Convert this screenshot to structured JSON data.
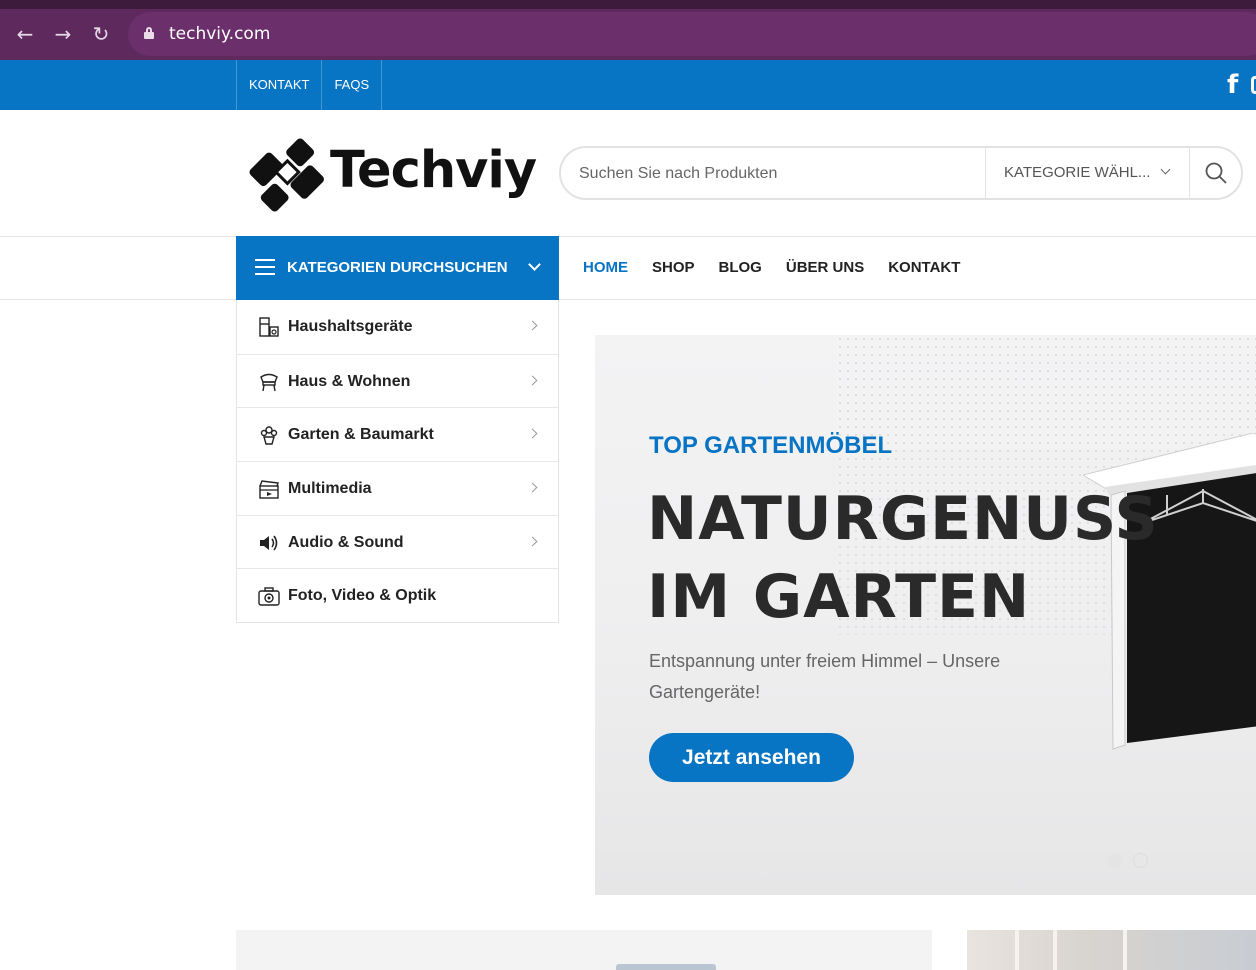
{
  "browser": {
    "url": "techviy.com"
  },
  "topbar": {
    "links": [
      "KONTAKT",
      "FAQS"
    ]
  },
  "header": {
    "logo_text": "Techviy",
    "search_placeholder": "Suchen Sie nach Produkten",
    "category_select": "KATEGORIE WÄHL..."
  },
  "categories": {
    "button_label": "KATEGORIEN DURCHSUCHEN",
    "items": [
      {
        "label": "Haushaltsgeräte",
        "icon": "appliance-icon",
        "has_arrow": true
      },
      {
        "label": "Haus & Wohnen",
        "icon": "chair-icon",
        "has_arrow": true
      },
      {
        "label": "Garten & Baumarkt",
        "icon": "plant-pot-icon",
        "has_arrow": true
      },
      {
        "label": "Multimedia",
        "icon": "clapperboard-icon",
        "has_arrow": true
      },
      {
        "label": "Audio & Sound",
        "icon": "speaker-icon",
        "has_arrow": true
      },
      {
        "label": "Foto, Video & Optik",
        "icon": "camera-icon",
        "has_arrow": false
      }
    ]
  },
  "nav": {
    "items": [
      "HOME",
      "SHOP",
      "BLOG",
      "ÜBER UNS",
      "KONTAKT"
    ],
    "active": "HOME"
  },
  "hero": {
    "kicker": "TOP GARTENMÖBEL",
    "headline_line1": "NATURGENUSS",
    "headline_line2": "IM GARTEN",
    "subtitle": "Entspannung unter freiem Himmel – Unsere Gartengeräte!",
    "cta": "Jetzt ansehen",
    "slides": 2,
    "active_slide": 1
  },
  "colors": {
    "brand_blue": "#0774c4",
    "browser_chrome": "#5e2a5e",
    "text_dark": "#222222"
  }
}
